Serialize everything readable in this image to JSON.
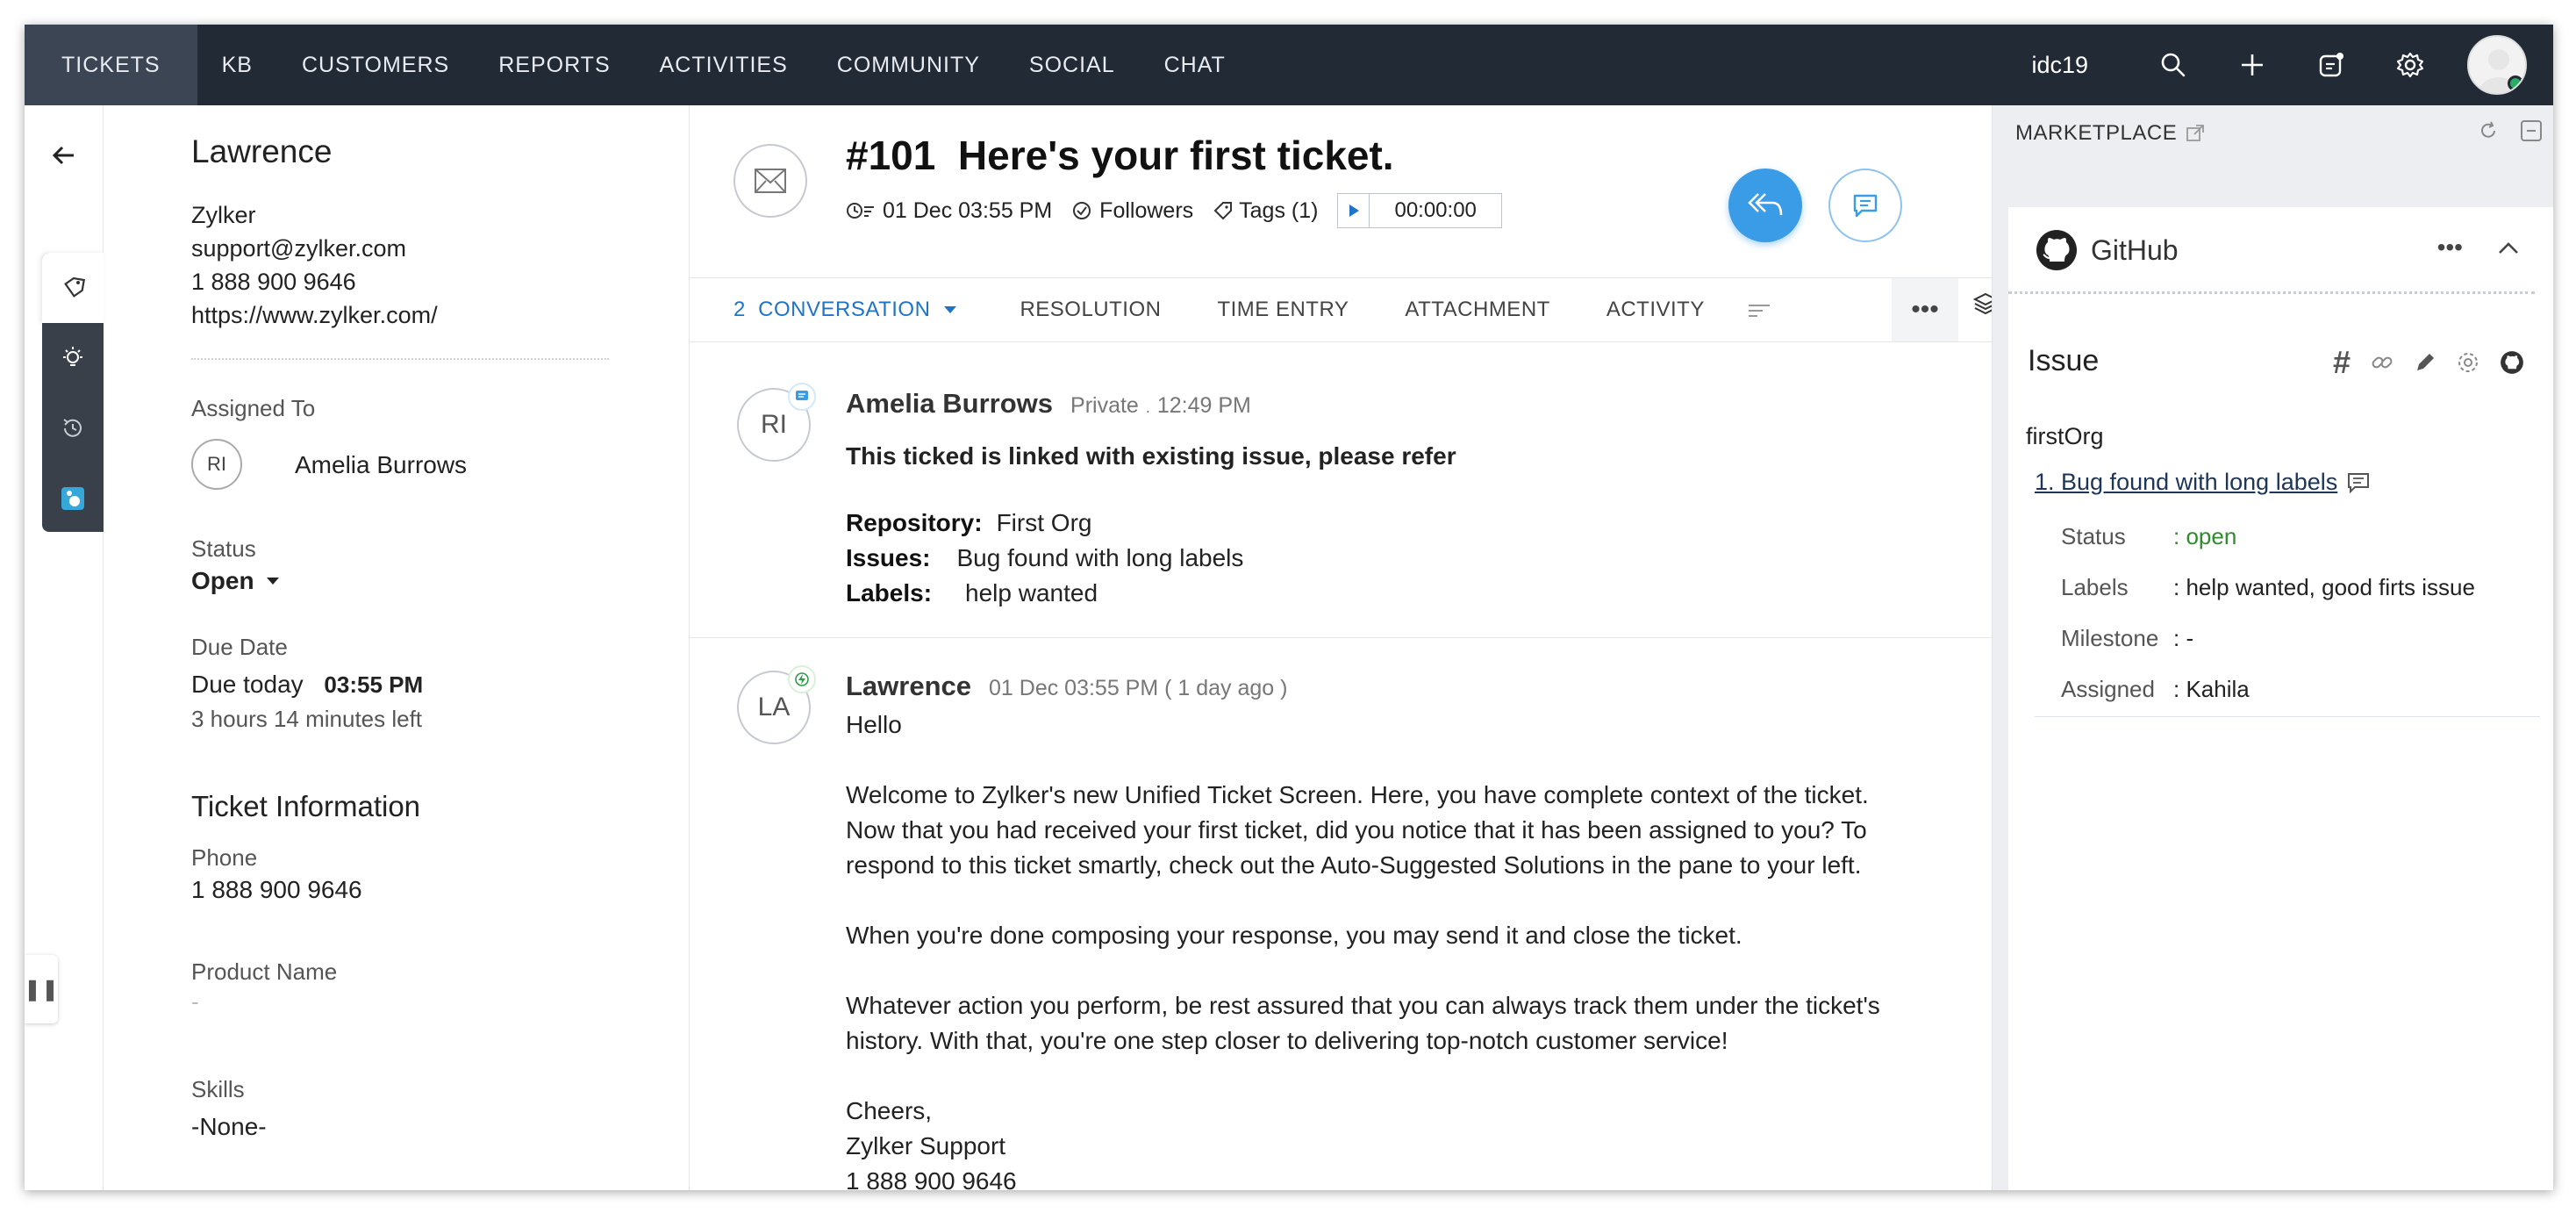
{
  "nav": {
    "tabs": [
      "TICKETS",
      "KB",
      "CUSTOMERS",
      "REPORTS",
      "ACTIVITIES",
      "COMMUNITY",
      "SOCIAL",
      "CHAT"
    ],
    "active_tab": "TICKETS",
    "org": "idc19",
    "icons": [
      "search-icon",
      "plus-icon",
      "notes-icon",
      "gear-icon",
      "avatar"
    ]
  },
  "contact": {
    "name": "Lawrence",
    "company": "Zylker",
    "email": "support@zylker.com",
    "phone": "1 888 900 9646",
    "website": "https://www.zylker.com/",
    "assigned_to_label": "Assigned To",
    "assignee_initials": "RI",
    "assignee_name": "Amelia Burrows",
    "status_label": "Status",
    "status_value": "Open",
    "due_date_label": "Due Date",
    "due_today": "Due today",
    "due_time": "03:55 PM",
    "time_left": "3 hours 14 minutes left",
    "ticket_info_heading": "Ticket Information",
    "phone_label": "Phone",
    "phone_value": "1 888 900 9646",
    "product_label": "Product Name",
    "product_value": "-",
    "skills_label": "Skills",
    "skills_value": "-None-"
  },
  "ticket": {
    "number": "#101",
    "title": "Here's your first ticket.",
    "created": "01 Dec 03:55 PM",
    "followers_label": "Followers",
    "tags_label": "Tags (1)",
    "timer": "00:00:00"
  },
  "tabs": {
    "conversation": "2  CONVERSATION",
    "resolution": "RESOLUTION",
    "time_entry": "TIME ENTRY",
    "attachment": "ATTACHMENT",
    "activity": "ACTIVITY"
  },
  "messages": [
    {
      "initials": "RI",
      "author": "Amelia Burrows",
      "visibility": "Private",
      "dot": ".",
      "time": "12:49 PM",
      "headline": "This ticked is linked with existing issue, please refer",
      "repo_label": "Repository:",
      "repo_value": "First Org",
      "issues_label": "Issues:",
      "issues_value": "Bug found with long labels",
      "labels_label": "Labels:",
      "labels_value": "help wanted"
    },
    {
      "initials": "LA",
      "author": "Lawrence",
      "time": "01 Dec 03:55 PM ( 1 day ago )",
      "p1": "Hello",
      "p2a": "Welcome to Zylker's new Unified Ticket Screen. Here, you have complete context of the ticket.",
      "p2b": "Now that you had received your first ticket, did you notice that it has been assigned to you? To",
      "p2c": "respond to this ticket smartly, check out the Auto-Suggested Solutions in the pane to your left.",
      "p3": "When you're done composing your response, you may send it and close the ticket.",
      "p4a": "Whatever action you perform, be rest assured that you can always track them under the ticket's",
      "p4b": "history. With that, you're one step closer to delivering top-notch customer service!",
      "p5a": "Cheers,",
      "p5b": "Zylker Support",
      "p5c": "1 888 900 9646"
    }
  ],
  "marketplace": {
    "heading": "MARKETPLACE",
    "app_name": "GitHub",
    "issue_heading": "Issue",
    "org": "firstOrg",
    "issue_link": "1. Bug found with long labels",
    "rows": [
      {
        "label": "Status",
        "value": ": open"
      },
      {
        "label": "Labels",
        "value": ": help wanted, good firts issue"
      },
      {
        "label": "Milestone",
        "value": ": -"
      },
      {
        "label": "Assigned",
        "value": ": Kahila"
      }
    ]
  },
  "colors": {
    "nav_bg": "#222a36",
    "accent": "#1e74c9",
    "reply_button": "#3a9be6",
    "status_open": "#2e8b2e"
  }
}
